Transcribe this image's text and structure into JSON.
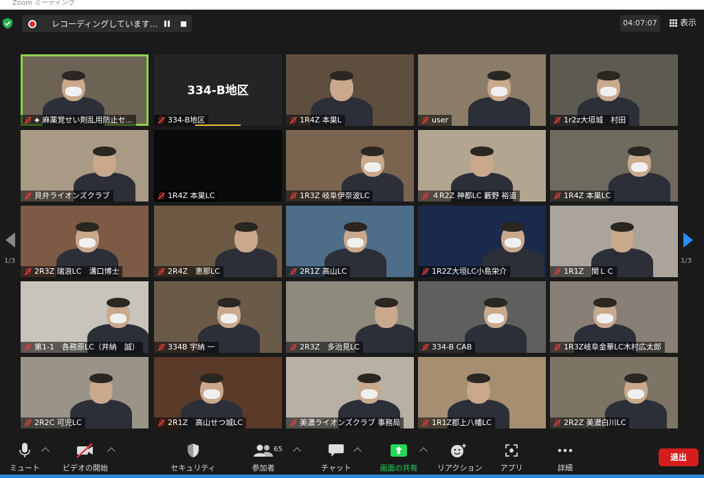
{
  "window": {
    "title": "Zoom ミーティング"
  },
  "topbar": {
    "recording_text": "レコーディングしています...",
    "timer": "04:07:07",
    "view_label": "表示"
  },
  "pager": {
    "left": "1/3",
    "right": "1/3"
  },
  "tiles": [
    {
      "name": "麻薬覚せい剤乱用防止セ...",
      "speaking": true,
      "pinned": true
    },
    {
      "name": "334-B地区",
      "center": "334-B地区"
    },
    {
      "name": "1R4Z 本巣L"
    },
    {
      "name": "user"
    },
    {
      "name": "1r2z大垣城　村田"
    },
    {
      "name": "貝弁ライオンズクラブ"
    },
    {
      "name": "1R4Z 本巣LC"
    },
    {
      "name": "1R3Z 岐阜伊奈波LC"
    },
    {
      "name": "４R2Z 神都LC 藪野 裕道"
    },
    {
      "name": "1R4Z 本巣LC"
    },
    {
      "name": "2R3Z 瑞浪LC　溝口博士"
    },
    {
      "name": "2R4Z　恵那LC"
    },
    {
      "name": "2R1Z 高山LC"
    },
    {
      "name": "1R2Z大垣LC小島栄介"
    },
    {
      "name": "1R1Z　関ＬＣ"
    },
    {
      "name": "第1-1　各務原LC（井納　誠）"
    },
    {
      "name": "334B 宇納 一"
    },
    {
      "name": "2R3Z　多治見LC"
    },
    {
      "name": "334-B CAB"
    },
    {
      "name": "1R3Z岐阜金華LC木村広太郎"
    },
    {
      "name": "2R2C 可児LC"
    },
    {
      "name": "2R1Z　高山せつ城LC"
    },
    {
      "name": "美濃ライオンズクラブ 事務局"
    },
    {
      "name": "1R1Z郡上八幡LC"
    },
    {
      "name": "2R2Z 美濃白川LC"
    }
  ],
  "toolbar": {
    "mute": "ミュート",
    "video": "ビデオの開始",
    "security": "セキュリティ",
    "participants": "参加者",
    "participants_count": "65",
    "chat": "チャット",
    "share": "画面の共有",
    "reactions": "リアクション",
    "apps": "アプリ",
    "more": "詳細",
    "leave": "退出"
  },
  "colors": {
    "speaker_border": "#8fd14f",
    "share_green": "#23d959",
    "leave_red": "#d41e1e",
    "accent_blue": "#2d8cff"
  }
}
